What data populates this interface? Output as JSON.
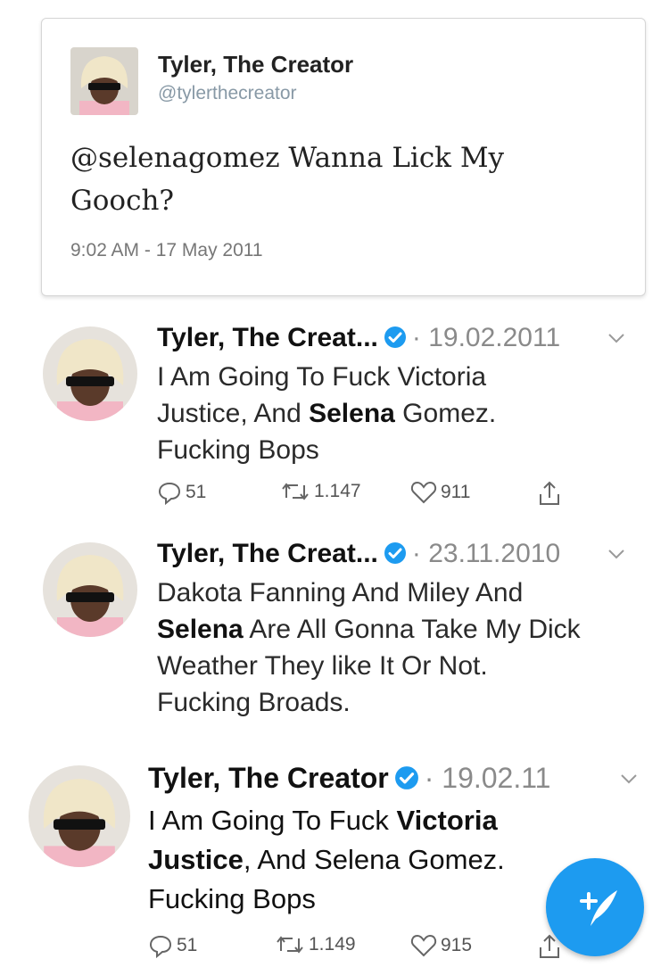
{
  "quoted_tweet": {
    "name": "Tyler, The Creator",
    "handle": "@tylerthecreator",
    "text": "@selenagomez Wanna Lick My Gooch?",
    "timestamp": "9:02 AM - 17 May 2011"
  },
  "tweets": [
    {
      "name": "Tyler, The Creat...",
      "date": "19.02.2011",
      "lines": [
        [
          {
            "t": "I Am Going To Fuck Victoria"
          }
        ],
        [
          {
            "t": "Justice, And "
          },
          {
            "t": "Selena",
            "b": true
          },
          {
            "t": " Gomez."
          }
        ],
        [
          {
            "t": "Fucking Bops"
          }
        ]
      ],
      "replies": "51",
      "retweets": "1.147",
      "likes": "911"
    },
    {
      "name": "Tyler, The Creat...",
      "date": "23.11.2010",
      "lines": [
        [
          {
            "t": "Dakota Fanning And Miley And"
          }
        ],
        [
          {
            "t": "Selena",
            "b": true
          },
          {
            "t": " Are All Gonna Take My Dick"
          }
        ],
        [
          {
            "t": "Weather They like It Or Not."
          }
        ],
        [
          {
            "t": "Fucking Broads."
          }
        ]
      ]
    },
    {
      "name": "Tyler, The Creator",
      "date": "19.02.11",
      "lines": [
        [
          {
            "t": "I Am Going To Fuck "
          },
          {
            "t": "Victoria",
            "b": true
          }
        ],
        [
          {
            "t": "Justice",
            "b": true
          },
          {
            "t": ", And Selena Gomez."
          }
        ],
        [
          {
            "t": "Fucking Bops"
          }
        ]
      ],
      "replies": "51",
      "retweets": "1.149",
      "likes": "915"
    }
  ],
  "icons": {
    "verified": "verified-badge-icon",
    "reply": "reply-icon",
    "retweet": "retweet-icon",
    "like": "heart-icon",
    "share": "share-icon",
    "compose": "compose-tweet-icon"
  },
  "colors": {
    "twitter_blue": "#1d9bf0",
    "muted_gray": "#8a8a8a"
  }
}
